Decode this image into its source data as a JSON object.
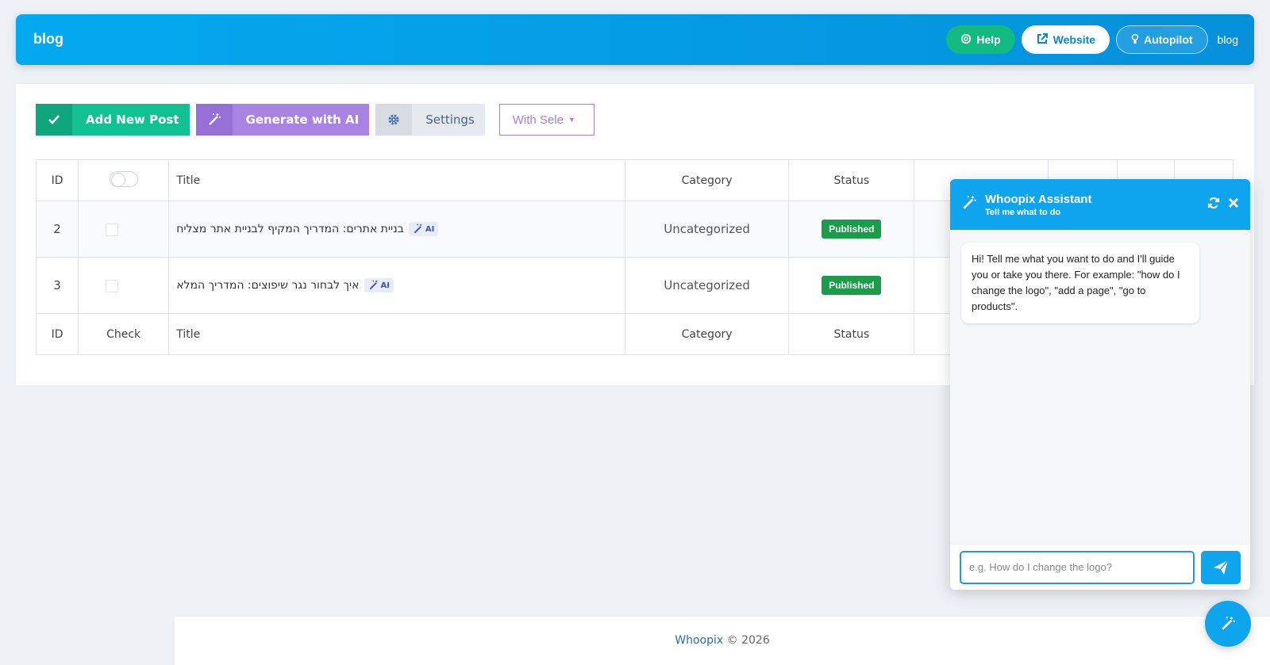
{
  "header": {
    "title": "blog",
    "help_label": "Help",
    "website_label": "Website",
    "autopilot_label": "Autopilot",
    "user_label": "blog"
  },
  "toolbar": {
    "add_label": "Add New Post",
    "generate_label": "Generate with AI",
    "settings_label": "Settings",
    "bulk_select_value": "With Sele"
  },
  "table": {
    "headers": [
      "ID",
      "",
      "Title",
      "Category",
      "Status"
    ],
    "footers": [
      "ID",
      "Check",
      "Title",
      "Category",
      "Status"
    ],
    "rows": [
      {
        "id": "2",
        "title": "בניית אתרים: המדריך המקיף לבניית אתר מצליח",
        "ai_tag": "AI",
        "category": "Uncategorized",
        "status": "Published"
      },
      {
        "id": "3",
        "title": "איך לבחור נגר שיפוצים: המדריך המלא",
        "ai_tag": "AI",
        "category": "Uncategorized",
        "status": "Published"
      }
    ]
  },
  "assistant": {
    "title": "Whoopix Assistant",
    "subtitle": "Tell me what to do",
    "greeting": "Hi! Tell me what you want to do and I'll guide you or take you there. For example: \"how do I change the logo\", \"add a page\", \"go to products\".",
    "input_placeholder": "e.g. How do I change the logo?"
  },
  "footer": {
    "brand": "Whoopix",
    "copyright": "© 2026"
  },
  "colors": {
    "header": "#04a9ef",
    "help": "#12b981",
    "add": "#12c192",
    "generate": "#a883e3",
    "published": "#1a9c4a",
    "assistant": "#0ea5ee"
  }
}
